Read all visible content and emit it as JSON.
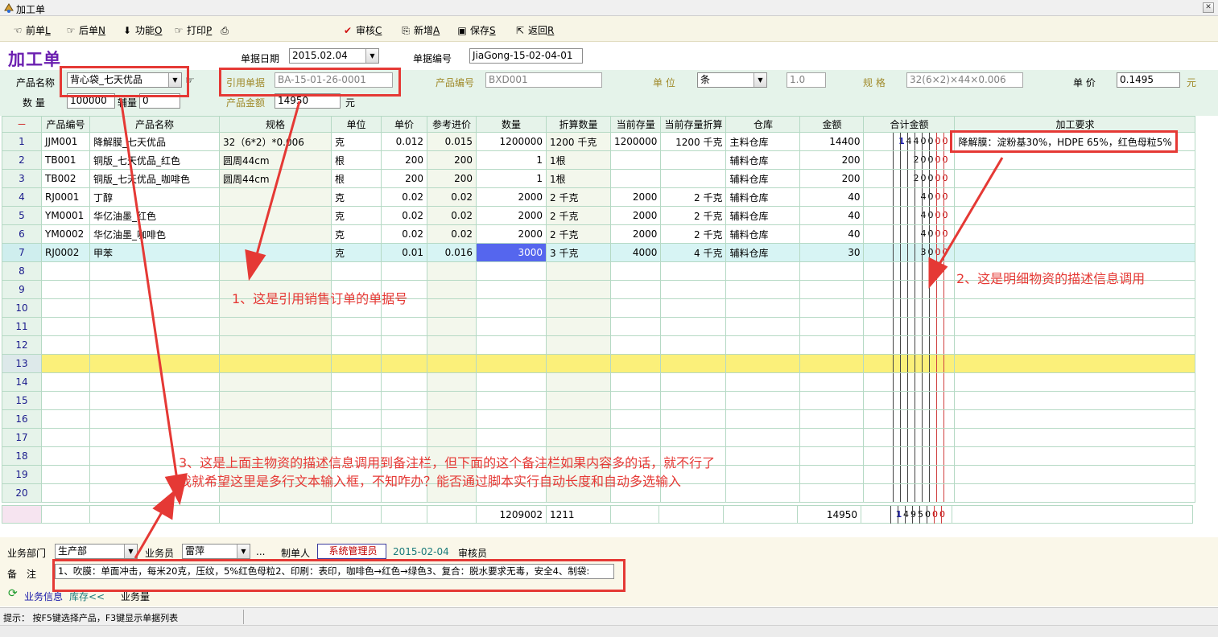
{
  "window": {
    "title": "加工单"
  },
  "toolbar": {
    "prev": {
      "text": "前单",
      "key": "L"
    },
    "next": {
      "text": "后单",
      "key": "N"
    },
    "func": {
      "text": "功能",
      "key": "O"
    },
    "print": {
      "text": "打印",
      "key": "P"
    },
    "audit": {
      "text": "审核",
      "key": "C"
    },
    "add": {
      "text": "新增",
      "key": "A"
    },
    "save": {
      "text": "保存",
      "key": "S"
    },
    "back": {
      "text": "返回",
      "key": "R"
    }
  },
  "header": {
    "form_title": "加工单",
    "doc_date_label": "单据日期",
    "doc_date": "2015.02.04",
    "doc_no_label": "单据编号",
    "doc_no": "JiaGong-15-02-04-01",
    "product_name_label": "产品名称",
    "product_name": "背心袋_七天优品",
    "ref_doc_label": "引用单据",
    "ref_doc": "BA-15-01-26-0001",
    "product_code_label": "产品编号",
    "product_code": "BXD001",
    "unit_label": "单 位",
    "unit": "条",
    "unit_ratio": "1.0",
    "spec_label": "规 格",
    "spec": "32(6×2)×44×0.006",
    "price_label": "单 价",
    "price": "0.1495",
    "price_unit": "元",
    "qty_label": "数 量",
    "qty": "100000",
    "aux_qty_label": "辅量",
    "aux_qty": "0",
    "amount_label": "产品金额",
    "amount": "14950",
    "amount_unit": "元"
  },
  "grid": {
    "rownum_header": "－",
    "columns": [
      "产品编号",
      "产品名称",
      "规格",
      "单位",
      "单价",
      "参考进价",
      "数量",
      "折算数量",
      "当前存量",
      "当前存量折算",
      "仓库",
      "金额",
      "合计金额",
      "加工要求"
    ],
    "rows": [
      {
        "n": "1",
        "code": "JJM001",
        "name": "降解膜_七天优品",
        "spec": "32（6*2）*0.006",
        "unit": "克",
        "price": "0.012",
        "ref": "0.015",
        "qty": "1200000",
        "conv": "1200 千克",
        "stock": "1200000",
        "stockconv": "1200 千克",
        "wh": "主料仓库",
        "amt": "14400",
        "total_digits": [
          "1",
          "4",
          "4",
          "0",
          "0",
          "0",
          "0"
        ],
        "req": "降解膜：淀粉基30%，HDPE 65%，红色母粒5%"
      },
      {
        "n": "2",
        "code": "TB001",
        "name": "铜版_七天优品_红色",
        "spec": "圆周44cm",
        "unit": "根",
        "price": "200",
        "ref": "200",
        "qty": "1",
        "conv": "1根",
        "stock": "",
        "stockconv": "",
        "wh": "辅料仓库",
        "amt": "200",
        "total_digits": [
          "",
          "",
          "2",
          "0",
          "0",
          "0",
          "0"
        ],
        "req": ""
      },
      {
        "n": "3",
        "code": "TB002",
        "name": "铜版_七天优品_咖啡色",
        "spec": "圆周44cm",
        "unit": "根",
        "price": "200",
        "ref": "200",
        "qty": "1",
        "conv": "1根",
        "stock": "",
        "stockconv": "",
        "wh": "辅料仓库",
        "amt": "200",
        "total_digits": [
          "",
          "",
          "2",
          "0",
          "0",
          "0",
          "0"
        ],
        "req": ""
      },
      {
        "n": "4",
        "code": "RJ0001",
        "name": "丁醇",
        "spec": "",
        "unit": "克",
        "price": "0.02",
        "ref": "0.02",
        "qty": "2000",
        "conv": "2 千克",
        "stock": "2000",
        "stockconv": "2 千克",
        "wh": "辅料仓库",
        "amt": "40",
        "total_digits": [
          "",
          "",
          "",
          "4",
          "0",
          "0",
          "0"
        ],
        "req": ""
      },
      {
        "n": "5",
        "code": "YM0001",
        "name": "华亿油墨_红色",
        "spec": "",
        "unit": "克",
        "price": "0.02",
        "ref": "0.02",
        "qty": "2000",
        "conv": "2 千克",
        "stock": "2000",
        "stockconv": "2 千克",
        "wh": "辅料仓库",
        "amt": "40",
        "total_digits": [
          "",
          "",
          "",
          "4",
          "0",
          "0",
          "0"
        ],
        "req": ""
      },
      {
        "n": "6",
        "code": "YM0002",
        "name": "华亿油墨_咖啡色",
        "spec": "",
        "unit": "克",
        "price": "0.02",
        "ref": "0.02",
        "qty": "2000",
        "conv": "2 千克",
        "stock": "2000",
        "stockconv": "2 千克",
        "wh": "辅料仓库",
        "amt": "40",
        "total_digits": [
          "",
          "",
          "",
          "4",
          "0",
          "0",
          "0"
        ],
        "req": ""
      },
      {
        "n": "7",
        "code": "RJ0002",
        "name": "甲苯",
        "spec": "",
        "unit": "克",
        "price": "0.01",
        "ref": "0.016",
        "qty": "3000",
        "conv": "3 千克",
        "stock": "4000",
        "stockconv": "4 千克",
        "wh": "辅料仓库",
        "amt": "30",
        "total_digits": [
          "",
          "",
          "",
          "3",
          "0",
          "0",
          "0"
        ],
        "req": ""
      }
    ],
    "empty_rows": [
      "8",
      "9",
      "10",
      "11",
      "12",
      "13",
      "14",
      "15",
      "16",
      "17",
      "18",
      "19",
      "20"
    ]
  },
  "totals": {
    "qty": "1209002",
    "conv": "1211",
    "amt": "14950",
    "total_digits": [
      "1",
      "4",
      "9",
      "5",
      "0",
      "0",
      "0"
    ]
  },
  "bottom": {
    "dept_label": "业务部门",
    "dept": "生产部",
    "salesman_label": "业务员",
    "salesman": "雷萍",
    "ellipsis": "...",
    "maker_label": "制单人",
    "maker": "系统管理员",
    "make_date": "2015-02-04",
    "auditor_label": "审核员",
    "remark_label": "备　注",
    "remark": "1、吹膜：单面冲击，每米20克，压纹，5%红色母粒2、印刷：表印，咖啡色→红色→绿色3、复合：脱水要求无毒，安全4、制袋:",
    "tab_biz": "业务信息",
    "tab_stock": "库存<<",
    "tab_qty": "业务量"
  },
  "status": {
    "hint": "提示： 按F5键选择产品，F3键显示单据列表"
  },
  "annotations": {
    "note1": "1、这是引用销售订单的单据号",
    "note2": "2、这是明细物资的描述信息调用",
    "note3_line1": "3、这是上面主物资的描述信息调用到备注栏，但下面的这个备注栏如果内容多的话，就不行了",
    "note3_line2": "我就希望这里是多行文本输入框，不知咋办？能否通过脚本实行自动长度和自动多选输入"
  },
  "colors": {
    "annotation_red": "#e53935",
    "title_purple": "#6b1fb0",
    "active_cell": "#5566ee",
    "yellow_row": "#fbf07a"
  }
}
